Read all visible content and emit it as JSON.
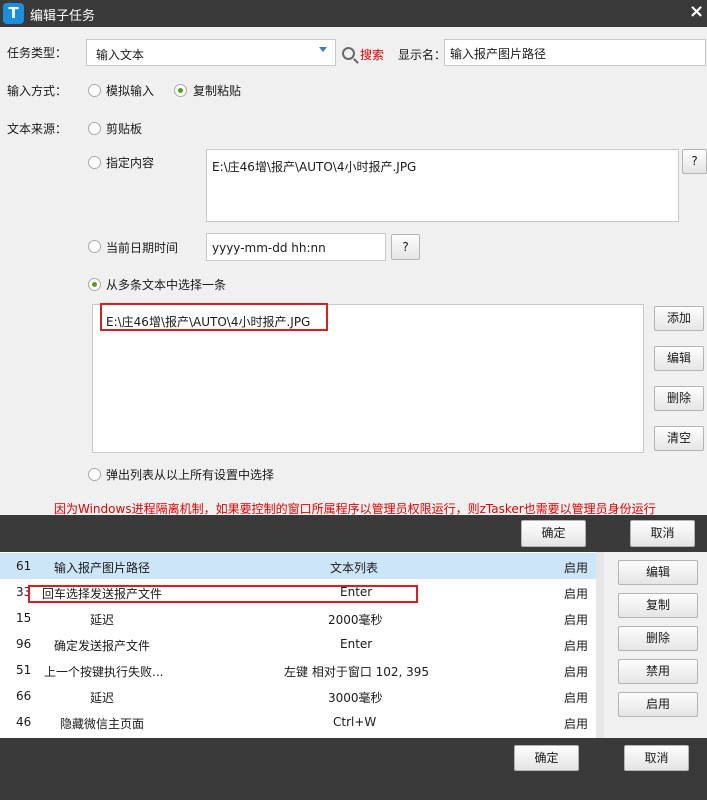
{
  "window": {
    "app_icon_letter": "T",
    "title": "编辑子任务",
    "close_symbol": "×"
  },
  "task_type": {
    "label": "任务类型：",
    "selected": "输入文本",
    "search_label": "搜索"
  },
  "display_name": {
    "label": "显示名：",
    "value": "输入报产图片路径"
  },
  "input_method": {
    "label": "输入方式：",
    "options": [
      {
        "label": "模拟输入",
        "selected": false
      },
      {
        "label": "复制粘贴",
        "selected": true
      }
    ]
  },
  "text_source": {
    "label": "文本来源：",
    "clipboard_label": "剪贴板",
    "specified_label": "指定内容",
    "specified_value": "E:\\庄46增\\报产\\AUTO\\4小时报产.JPG",
    "help_label": "?",
    "date_label": "当前日期时间",
    "date_format": "yyyy-mm-dd hh:nn",
    "date_help_label": "?",
    "multi_label": "从多条文本中选择一条",
    "multi_items": [
      "E:\\庄46增\\报产\\AUTO\\4小时报产.JPG"
    ],
    "popup_label": "弹出列表从以上所有设置中选择"
  },
  "multi_buttons": {
    "add": "添加",
    "edit": "编辑",
    "delete": "删除",
    "clear": "清空"
  },
  "warning": "因为Windows进程隔离机制，如果要控制的窗口所属程序以管理员权限运行，则zTasker也需要以管理员身份运行",
  "dialog_buttons": {
    "ok": "确定",
    "cancel": "取消"
  },
  "task_list": {
    "rows": [
      {
        "id": "61",
        "name": "输入报产图片路径",
        "detail": "文本列表",
        "status": "启用"
      },
      {
        "id": "33",
        "name": "回车选择发送报产文件",
        "detail": "Enter",
        "status": "启用"
      },
      {
        "id": "15",
        "name": "延迟",
        "detail": "2000毫秒",
        "status": "启用"
      },
      {
        "id": "96",
        "name": "确定发送报产文件",
        "detail": "Enter",
        "status": "启用"
      },
      {
        "id": "51",
        "name": "上一个按键执行失败...",
        "detail": "左键 相对于窗口 102, 395",
        "status": "启用"
      },
      {
        "id": "66",
        "name": "延迟",
        "detail": "3000毫秒",
        "status": "启用"
      },
      {
        "id": "46",
        "name": "隐藏微信主页面",
        "detail": "Ctrl+W",
        "status": "启用"
      }
    ],
    "buttons": {
      "edit": "编辑",
      "copy": "复制",
      "delete": "删除",
      "disable": "禁用",
      "enable": "启用"
    }
  },
  "bottom_buttons": {
    "ok": "确定",
    "cancel": "取消"
  },
  "colors": {
    "accent_radio": "#50a020",
    "warning_red": "#e00000",
    "highlight_box": "#d42020",
    "selected_row": "#cde6f7",
    "dark_frame": "#3a3a3a"
  }
}
